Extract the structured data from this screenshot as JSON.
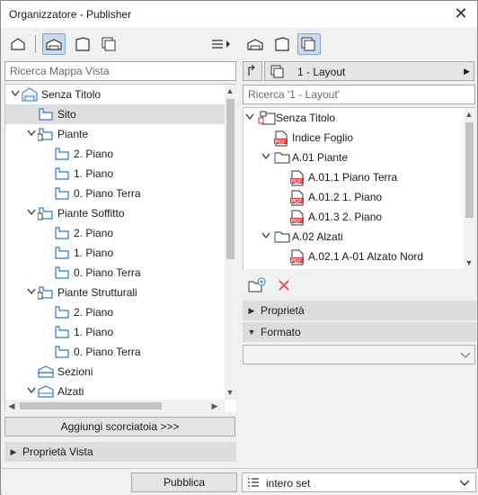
{
  "window": {
    "title": "Organizzatore - Publisher",
    "close_glyph": "✕"
  },
  "left": {
    "search_placeholder": "Ricerca Mappa Vista",
    "tree": [
      {
        "label": "Senza Titolo",
        "level": 0,
        "expand": "open",
        "icon": "project-icon"
      },
      {
        "label": "Sito",
        "level": 1,
        "expand": "none",
        "icon": "story-icon",
        "selected": true
      },
      {
        "label": "Piante",
        "level": 1,
        "expand": "open",
        "icon": "plan-folder-icon"
      },
      {
        "label": "2. Piano",
        "level": 2,
        "expand": "none",
        "icon": "story-icon"
      },
      {
        "label": "1. Piano",
        "level": 2,
        "expand": "none",
        "icon": "story-icon"
      },
      {
        "label": "0. Piano Terra",
        "level": 2,
        "expand": "none",
        "icon": "story-icon"
      },
      {
        "label": "Piante Soffitto",
        "level": 1,
        "expand": "open",
        "icon": "plan-folder-icon"
      },
      {
        "label": "2. Piano",
        "level": 2,
        "expand": "none",
        "icon": "story-icon"
      },
      {
        "label": "1. Piano",
        "level": 2,
        "expand": "none",
        "icon": "story-icon"
      },
      {
        "label": "0. Piano Terra",
        "level": 2,
        "expand": "none",
        "icon": "story-icon"
      },
      {
        "label": "Piante Strutturali",
        "level": 1,
        "expand": "open",
        "icon": "plan-folder-icon"
      },
      {
        "label": "2. Piano",
        "level": 2,
        "expand": "none",
        "icon": "story-icon"
      },
      {
        "label": "1. Piano",
        "level": 2,
        "expand": "none",
        "icon": "story-icon"
      },
      {
        "label": "0. Piano Terra",
        "level": 2,
        "expand": "none",
        "icon": "story-icon"
      },
      {
        "label": "Sezioni",
        "level": 1,
        "expand": "none",
        "icon": "section-icon"
      },
      {
        "label": "Alzati",
        "level": 1,
        "expand": "open",
        "icon": "elevation-icon"
      }
    ],
    "shortcut_button": "Aggiungi scorciatoia >>>",
    "view_props": "Proprietà Vista"
  },
  "right": {
    "layout_select": "1 - Layout",
    "search_placeholder": "Ricerca '1 - Layout'",
    "tree": [
      {
        "label": "Senza Titolo",
        "level": 0,
        "expand": "open",
        "icon": "publisher-root-icon"
      },
      {
        "label": "Indice Foglio",
        "level": 1,
        "expand": "none",
        "icon": "pdf-icon"
      },
      {
        "label": "A.01 Piante",
        "level": 1,
        "expand": "open",
        "icon": "folder-icon"
      },
      {
        "label": "A.01.1 Piano Terra",
        "level": 2,
        "expand": "none",
        "icon": "pdf-icon"
      },
      {
        "label": "A.01.2 1. Piano",
        "level": 2,
        "expand": "none",
        "icon": "pdf-icon"
      },
      {
        "label": "A.01.3 2. Piano",
        "level": 2,
        "expand": "none",
        "icon": "pdf-icon"
      },
      {
        "label": "A.02 Alzati",
        "level": 1,
        "expand": "open",
        "icon": "folder-icon"
      },
      {
        "label": "A.02.1 A-01 Alzato Nord",
        "level": 2,
        "expand": "none",
        "icon": "pdf-icon"
      }
    ],
    "panel_props": "Proprietà",
    "panel_format": "Formato"
  },
  "bottom": {
    "publish_button": "Pubblica",
    "set_select": "intero set"
  }
}
